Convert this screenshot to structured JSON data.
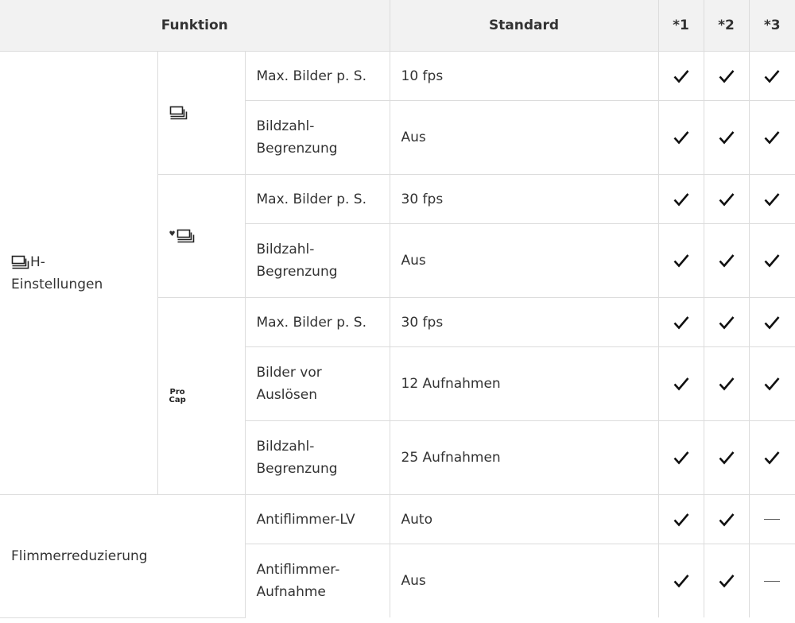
{
  "header": {
    "funktion": "Funktion",
    "standard": "Standard",
    "col1": "*1",
    "col2": "*2",
    "col3": "*3"
  },
  "groups": {
    "h_settings": "H-\nEinstellungen",
    "flicker": "Flimmerreduzierung"
  },
  "icons": {
    "burst": "sequential-shooting-icon",
    "silent_burst": "silent-sequential-shooting-icon",
    "procap_line1": "Pro",
    "procap_line2": "Cap"
  },
  "rows": [
    {
      "setting": "Max. Bilder p. S.",
      "standard": "10 fps",
      "marks": [
        "check",
        "check",
        "check"
      ]
    },
    {
      "setting": "Bildzahl-\nBegrenzung",
      "standard": "Aus",
      "marks": [
        "check",
        "check",
        "check"
      ]
    },
    {
      "setting": "Max. Bilder p. S.",
      "standard": "30 fps",
      "marks": [
        "check",
        "check",
        "check"
      ]
    },
    {
      "setting": "Bildzahl-\nBegrenzung",
      "standard": "Aus",
      "marks": [
        "check",
        "check",
        "check"
      ]
    },
    {
      "setting": "Max. Bilder p. S.",
      "standard": "30 fps",
      "marks": [
        "check",
        "check",
        "check"
      ]
    },
    {
      "setting": "Bilder vor\nAuslösen",
      "standard": "12 Aufnahmen",
      "marks": [
        "check",
        "check",
        "check"
      ]
    },
    {
      "setting": "Bildzahl-\nBegrenzung",
      "standard": "25 Aufnahmen",
      "marks": [
        "check",
        "check",
        "check"
      ]
    },
    {
      "setting": "Antiflimmer-LV",
      "standard": "Auto",
      "marks": [
        "check",
        "check",
        "dash"
      ]
    },
    {
      "setting": "Antiflimmer-\nAufnahme",
      "standard": "Aus",
      "marks": [
        "check",
        "check",
        "dash"
      ]
    }
  ]
}
